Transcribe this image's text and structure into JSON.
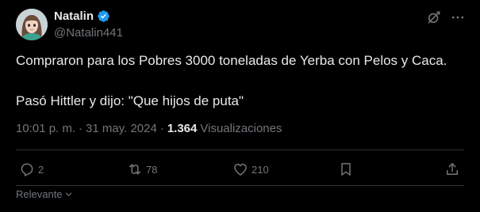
{
  "author": {
    "display_name": "Natalin",
    "handle": "@Natalin441",
    "verified": true,
    "verified_color": "#1d9bf0"
  },
  "tweet": {
    "line1": "Compraron para los Pobres 3000 toneladas de Yerba con Pelos y Caca.",
    "line2": "Pasó Hittler y dijo: \"Que hijos de puta\""
  },
  "meta": {
    "time": "10:01 p. m.",
    "separator1": "·",
    "date": "31 may. 2024",
    "separator2": "·",
    "views_count": "1.364",
    "views_label": "Visualizaciones"
  },
  "actions": {
    "replies": "2",
    "reposts": "78",
    "likes": "210"
  },
  "sort": {
    "label": "Relevante"
  },
  "colors": {
    "background": "#000000",
    "text": "#e7e9ea",
    "muted": "#71767b",
    "divider": "#2f3336",
    "accent": "#1d9bf0"
  },
  "icons": {
    "header": [
      "grok-icon",
      "more-icon"
    ],
    "actions": [
      "reply-icon",
      "repost-icon",
      "like-icon",
      "bookmark-icon",
      "share-icon"
    ]
  }
}
